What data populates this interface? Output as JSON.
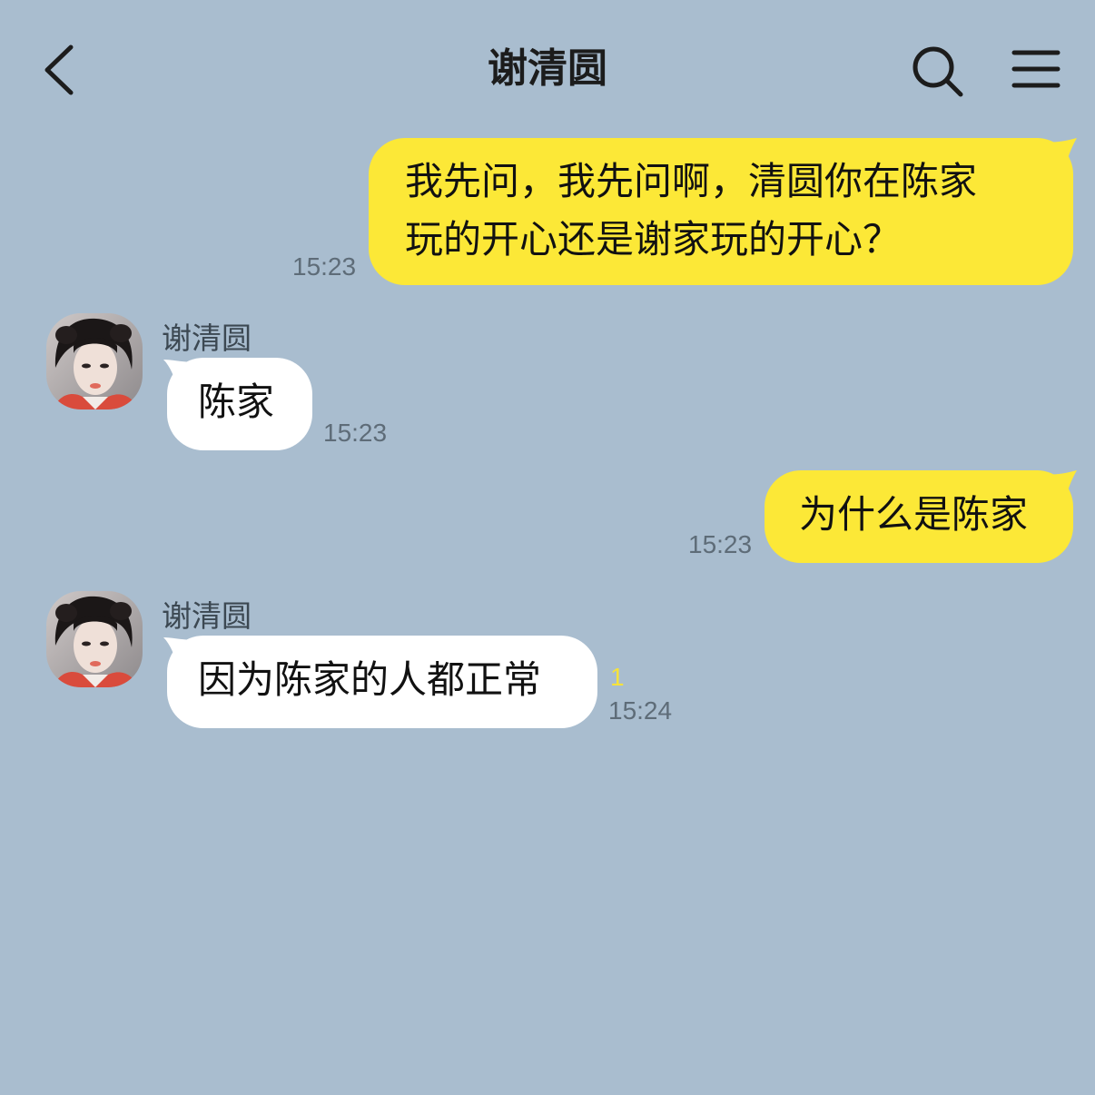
{
  "header": {
    "title": "谢清圆",
    "back_icon": "chevron-left-icon",
    "search_icon": "search-icon",
    "menu_icon": "hamburger-menu-icon"
  },
  "colors": {
    "background": "#a9bdcf",
    "my_bubble": "#fce837",
    "their_bubble": "#ffffff",
    "unread": "#f6e33a"
  },
  "messages": [
    {
      "from": "me",
      "lines": [
        "我先问，我先问啊，清圆你在陈家",
        "玩的开心还是谢家玩的开心？"
      ],
      "time": "15:23"
    },
    {
      "from": "other",
      "sender": "谢清圆",
      "text": "陈家",
      "time": "15:23"
    },
    {
      "from": "me",
      "text": "为什么是陈家",
      "time": "15:23"
    },
    {
      "from": "other",
      "sender": "谢清圆",
      "text": "因为陈家的人都正常",
      "unread": "1",
      "time": "15:24"
    }
  ]
}
